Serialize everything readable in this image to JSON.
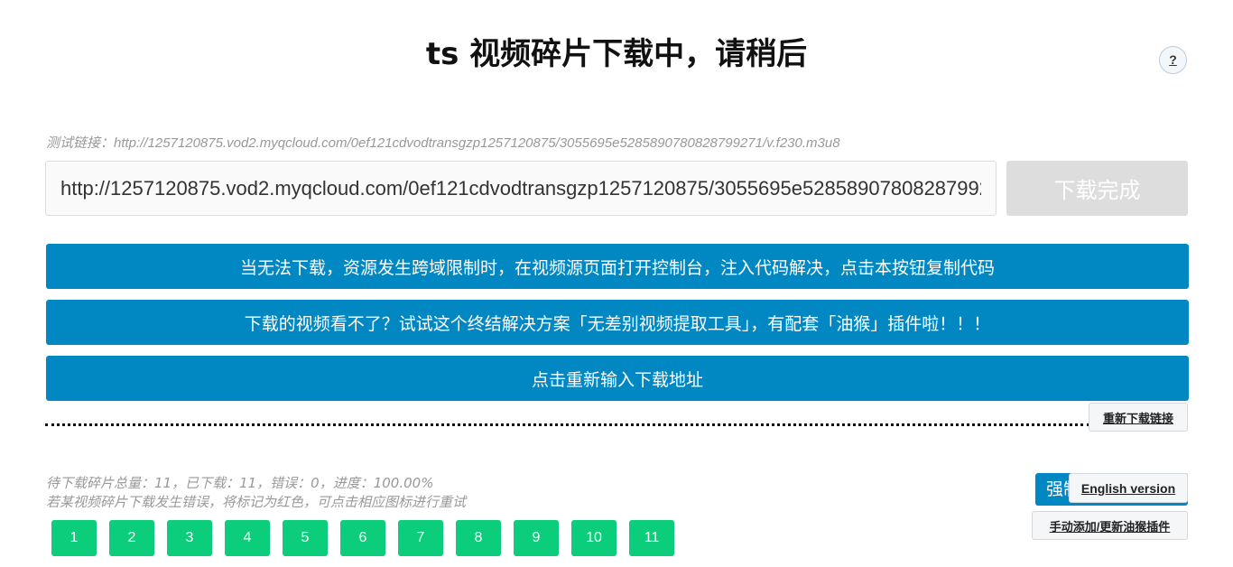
{
  "header": {
    "title": "ts 视频碎片下载中，请稍后",
    "help_label": "?"
  },
  "form": {
    "test_link": "测试链接：http://1257120875.vod2.myqcloud.com/0ef121cdvodtransgzp1257120875/3055695e5285890780828799271/v.f230.m3u8",
    "url_value": "http://1257120875.vod2.myqcloud.com/0ef121cdvodtransgzp1257120875/3055695e5285890780828799271/v.f230.m3u8",
    "download_label": "下载完成"
  },
  "actions": {
    "copy_code": "当无法下载，资源发生跨域限制时，在视频源页面打开控制台，注入代码解决，点击本按钮复制代码",
    "tool": "下载的视频看不了？试试这个终结解决方案「无差别视频提取工具」，有配套「油猴」插件啦！！！",
    "reenter": "点击重新输入下载地址",
    "relink": "重新下载链接"
  },
  "status": {
    "summary": "待下载碎片总量：11，已下载：11，错误：0，进度：100.00%",
    "hint": "若某视频碎片下载发生错误，将标记为红色，可点击相应图标进行重试",
    "progress_percent": 100
  },
  "segments": [
    "1",
    "2",
    "3",
    "4",
    "5",
    "6",
    "7",
    "8",
    "9",
    "10",
    "11"
  ],
  "side": {
    "force_label": "强制下载",
    "english": "English version",
    "manual": "手动添加/更新油猴插件"
  },
  "colors": {
    "primary": "#0188c3",
    "segment_done": "#0bcd7c",
    "disabled": "#dddddd"
  }
}
